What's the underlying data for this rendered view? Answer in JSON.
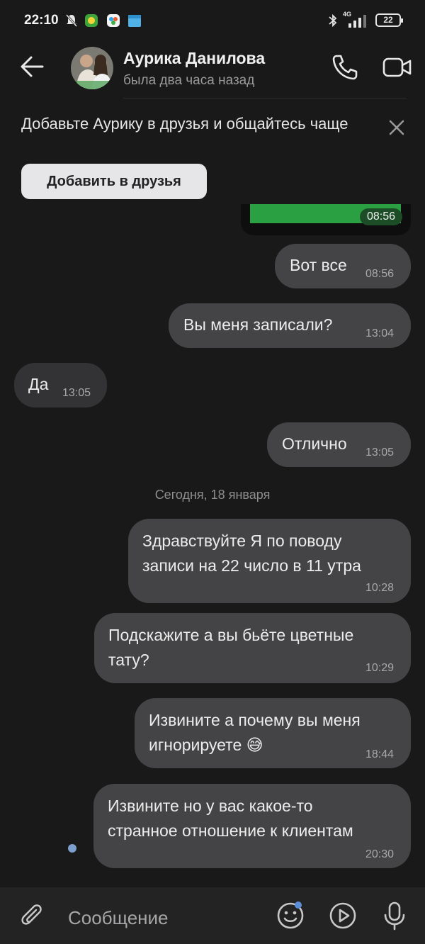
{
  "status_bar": {
    "time": "22:10",
    "network": "4G",
    "battery": "22"
  },
  "header": {
    "contact_name": "Аурика Данилова",
    "last_seen": "была два часа назад"
  },
  "banner": {
    "text": "Добавьте Аурику в друзья и общайтесь чаще",
    "button_label": "Добавить в друзья"
  },
  "prev_message": {
    "time": "08:56"
  },
  "messages": [
    {
      "dir": "out",
      "lines": [
        "Вот все"
      ],
      "time": "08:56"
    },
    {
      "dir": "out",
      "lines": [
        "Вы меня записали?"
      ],
      "time": "13:04"
    },
    {
      "dir": "in",
      "lines": [
        "Да"
      ],
      "time": "13:05"
    },
    {
      "dir": "out",
      "lines": [
        "Отлично"
      ],
      "time": "13:05"
    },
    {
      "dir": "out",
      "lines": [
        "Здравствуйте Я по поводу",
        "записи на 22 число в 11 утра"
      ],
      "time": "10:28"
    },
    {
      "dir": "out",
      "lines": [
        "Подскажите а вы бьёте цветные",
        "тату?"
      ],
      "time": "10:29"
    },
    {
      "dir": "out",
      "lines": [
        "Извините а почему вы меня",
        "игнорируете 😅"
      ],
      "time": "18:44"
    },
    {
      "dir": "out",
      "lines": [
        "Извините но у вас какое-то",
        "странное отношение к клиентам"
      ],
      "time": "20:30"
    }
  ],
  "date_separator": "Сегодня, 18 января",
  "composer": {
    "placeholder": "Сообщение"
  },
  "icons": {
    "back": "arrow-left-icon",
    "call": "phone-icon",
    "video": "video-camera-icon",
    "close": "close-icon",
    "attach": "paperclip-icon",
    "emoji": "smiley-icon",
    "play": "play-circle-icon",
    "mic": "microphone-icon"
  },
  "colors": {
    "background": "#191919",
    "bubble_out": "#444446",
    "bubble_in": "#333335",
    "accent": "#5a8ed8"
  }
}
